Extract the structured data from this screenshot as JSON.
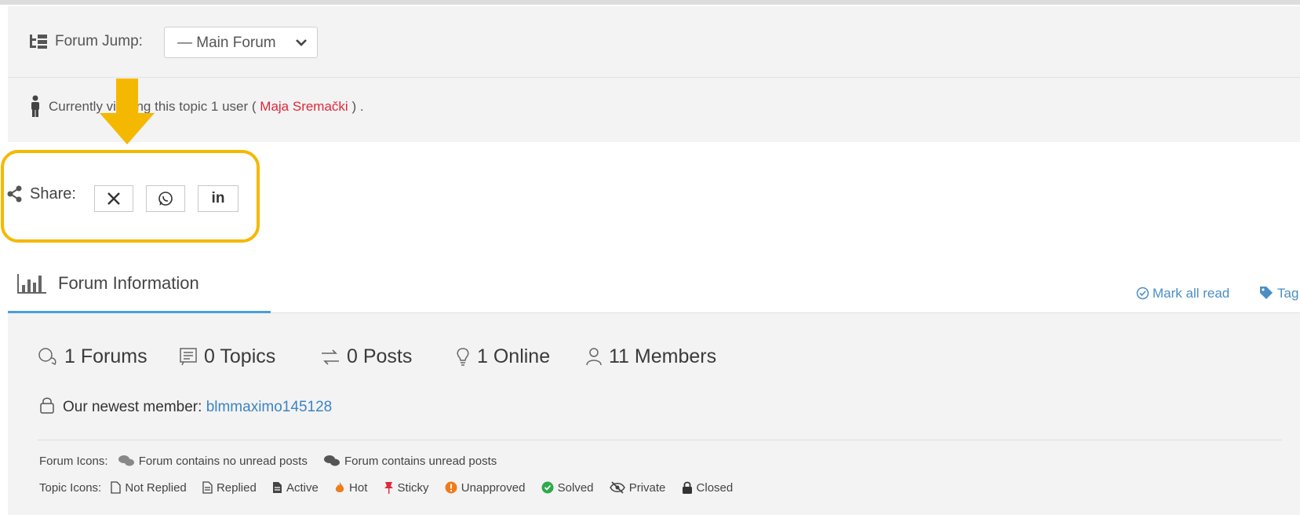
{
  "forum_jump": {
    "label": "Forum Jump:",
    "selected": "— Main Forum"
  },
  "viewing": {
    "prefix": "Currently viewing this topic 1 user (",
    "user": "Maja Sremački",
    "suffix": ") ."
  },
  "share": {
    "label": "Share:",
    "buttons": [
      "x-twitter-icon",
      "whatsapp-icon",
      "linkedin-icon"
    ],
    "linkedin_text": "in"
  },
  "forum_info": {
    "title": "Forum Information",
    "mark_all_read": "Mark all read",
    "tags": "Tag"
  },
  "stats": {
    "forums": "1 Forums",
    "topics": "0 Topics",
    "posts": "0 Posts",
    "online": "1 Online",
    "members": "11 Members"
  },
  "newest": {
    "label": "Our newest member:",
    "member": "blmmaximo145128"
  },
  "legend": {
    "forum_label": "Forum Icons:",
    "forum_items": [
      "Forum contains no unread posts",
      "Forum contains unread posts"
    ],
    "topic_label": "Topic Icons:",
    "topic_items": [
      "Not Replied",
      "Replied",
      "Active",
      "Hot",
      "Sticky",
      "Unapproved",
      "Solved",
      "Private",
      "Closed"
    ]
  },
  "colors": {
    "highlight": "#f5b800",
    "accent_blue": "#4a9fd8",
    "user_red": "#e0283a"
  }
}
